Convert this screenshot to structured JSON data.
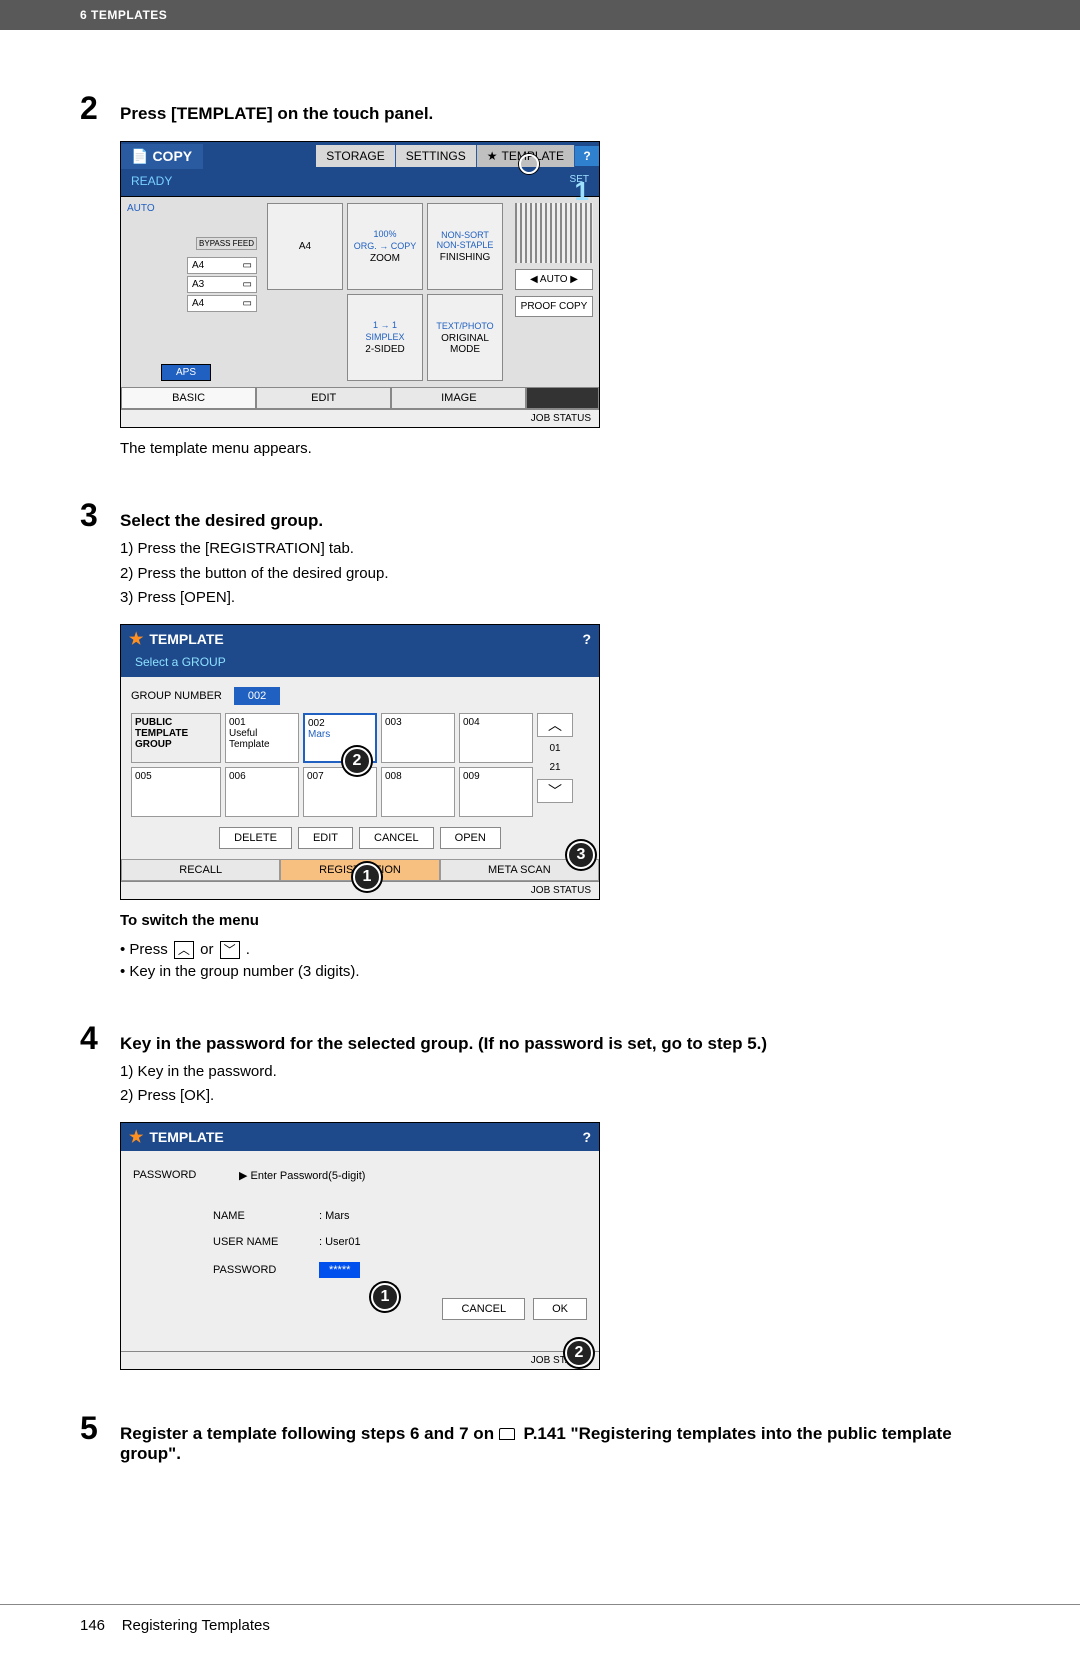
{
  "header_tag": "6 TEMPLATES",
  "steps": {
    "s2": {
      "num": "2",
      "title": "Press [TEMPLATE] on the touch panel.",
      "caption": "The template menu appears."
    },
    "s3": {
      "num": "3",
      "title": "Select the desired group.",
      "items": {
        "i1": "1)   Press the [REGISTRATION] tab.",
        "i2": "2)   Press the button of the desired group.",
        "i3": "3)   Press [OPEN]."
      },
      "switch_title": "To switch the menu",
      "switch_b1_pre": "Press ",
      "switch_b1_mid": " or ",
      "switch_b1_post": " .",
      "switch_b2": "Key in the group number (3 digits)."
    },
    "s4": {
      "num": "4",
      "title": "Key in the password for the selected group. (If no password is set, go to step 5.)",
      "items": {
        "i1": "1)   Key in the password.",
        "i2": "2)   Press [OK]."
      }
    },
    "s5": {
      "num": "5",
      "title_pre": "Register a template following steps 6 and 7 on ",
      "title_link": " P.141 \"Registering templates into the public template group\".",
      "title_post": ""
    }
  },
  "screen1": {
    "copy": "COPY",
    "storage": "STORAGE",
    "settings": "SETTINGS",
    "template": "TEMPLATE",
    "help": "?",
    "ready": "READY",
    "set": "SET",
    "counter": "1",
    "auto": "AUTO",
    "bypass": "BYPASS FEED",
    "trays": {
      "a4": "A4",
      "a3": "A3",
      "a4b": "A4"
    },
    "aps": "APS",
    "center": {
      "pct": "100%",
      "orig_copy": "ORG. → COPY",
      "zoom": "ZOOM",
      "nonsort": "NON-SORT NON-STAPLE",
      "finishing": "FINISHING",
      "simplex_top": "1 → 1",
      "simplex": "SIMPLEX",
      "two_sided": "2-SIDED",
      "text_photo": "TEXT/PHOTO",
      "orig_mode": "ORIGINAL MODE",
      "a4": "A4"
    },
    "right": {
      "auto_btn": "AUTO",
      "proof": "PROOF COPY"
    },
    "btabs": {
      "basic": "BASIC",
      "edit": "EDIT",
      "image": "IMAGE"
    },
    "job_status": "JOB STATUS"
  },
  "screen2": {
    "title": "TEMPLATE",
    "subtitle": "Select a GROUP",
    "help": "?",
    "group_number_label": "GROUP NUMBER",
    "group_number_value": "002",
    "public_group": "PUBLIC TEMPLATE GROUP",
    "cells": {
      "c001": "001",
      "c001b": "Useful Template",
      "c002": "002",
      "c002b": "Mars",
      "c003": "003",
      "c004": "004",
      "c005": "005",
      "c006": "006",
      "c007": "007",
      "c008": "008",
      "c009": "009"
    },
    "page": {
      "top": "01",
      "of": "21"
    },
    "btns": {
      "delete": "DELETE",
      "edit": "EDIT",
      "cancel": "CANCEL",
      "open": "OPEN"
    },
    "tabs": {
      "recall": "RECALL",
      "registration": "REGISTRATION",
      "meta": "META SCAN"
    },
    "job_status": "JOB STATUS"
  },
  "screen3": {
    "title": "TEMPLATE",
    "help": "?",
    "password_label": "PASSWORD",
    "password_hint": "▶ Enter Password(5-digit)",
    "name_label": "NAME",
    "name_value": ": Mars",
    "user_label": "USER NAME",
    "user_value": ": User01",
    "pw_field_label": "PASSWORD",
    "pw_field_value": "*****",
    "cancel": "CANCEL",
    "ok": "OK",
    "job_status": "JOB STATUS"
  },
  "footer": {
    "page": "146",
    "title": "Registering Templates"
  },
  "anno": {
    "n1": "1",
    "n2": "2",
    "n3": "3"
  }
}
